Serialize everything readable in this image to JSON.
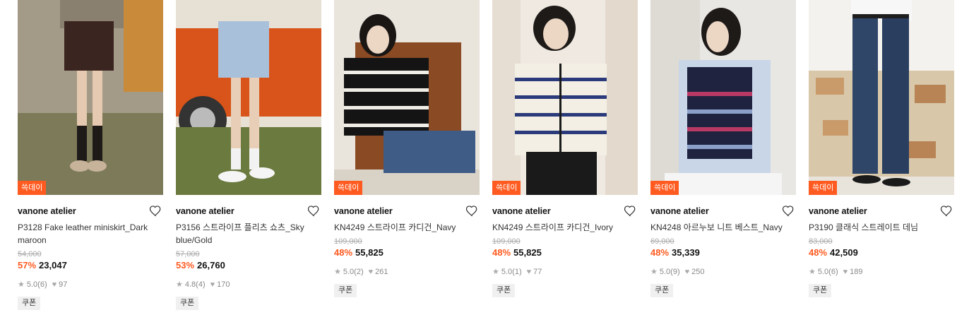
{
  "products": [
    {
      "badge": "쓱데이",
      "brand": "vanone atelier",
      "name": "P3128 Fake leather miniskirt_Dark maroon",
      "original_price": "54,000",
      "discount": "57%",
      "price": "23,047",
      "rating": "5.0",
      "reviews": "(6)",
      "likes": "97",
      "coupon": "쿠폰"
    },
    {
      "badge": "",
      "brand": "vanone atelier",
      "name": "P3156 스트라이프 플리츠 쇼츠_Sky blue/Gold",
      "original_price": "57,000",
      "discount": "53%",
      "price": "26,760",
      "rating": "4.8",
      "reviews": "(4)",
      "likes": "170",
      "coupon": "쿠폰"
    },
    {
      "badge": "쓱데이",
      "brand": "vanone atelier",
      "name": "KN4249 스트라이프 카디건_Navy",
      "original_price": "109,000",
      "discount": "48%",
      "price": "55,825",
      "rating": "5.0",
      "reviews": "(2)",
      "likes": "261",
      "coupon": "쿠폰"
    },
    {
      "badge": "쓱데이",
      "brand": "vanone atelier",
      "name": "KN4249 스트라이프 카디건_Ivory",
      "original_price": "109,000",
      "discount": "48%",
      "price": "55,825",
      "rating": "5.0",
      "reviews": "(1)",
      "likes": "77",
      "coupon": "쿠폰"
    },
    {
      "badge": "쓱데이",
      "brand": "vanone atelier",
      "name": "KN4248 아르누보 니트 베스트_Navy",
      "original_price": "69,000",
      "discount": "48%",
      "price": "35,339",
      "rating": "5.0",
      "reviews": "(9)",
      "likes": "250",
      "coupon": "쿠폰"
    },
    {
      "badge": "쓱데이",
      "brand": "vanone atelier",
      "name": "P3190 클래식 스트레이트 데님",
      "original_price": "83,000",
      "discount": "48%",
      "price": "42,509",
      "rating": "5.0",
      "reviews": "(6)",
      "likes": "189",
      "coupon": "쿠폰"
    }
  ],
  "colors": {
    "accent": "#ff5a1f",
    "strike": "#aaaaaa",
    "meta": "#888888",
    "coupon_bg": "#f0f0f0"
  },
  "icons": {
    "wishlist": "heart-outline-icon",
    "rating": "star-icon",
    "likes": "heart-filled-icon"
  }
}
